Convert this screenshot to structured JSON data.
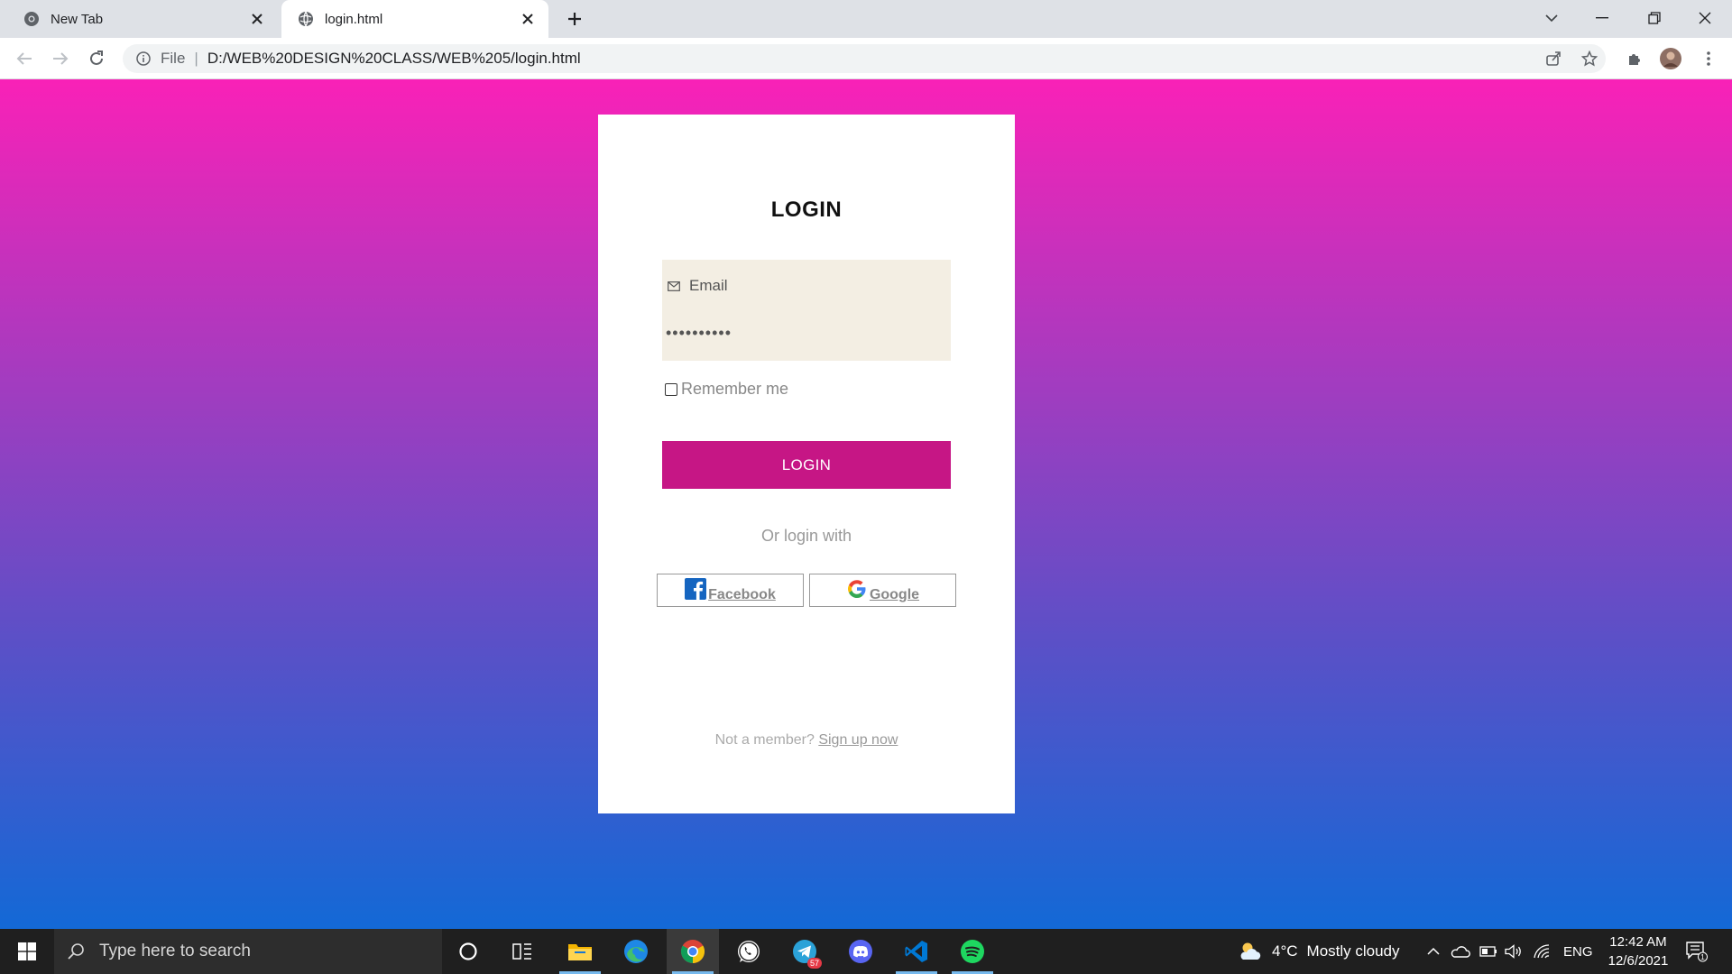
{
  "browser": {
    "tabs": [
      {
        "title": "New Tab",
        "active": false
      },
      {
        "title": "login.html",
        "active": true
      }
    ],
    "address": {
      "scheme_label": "File",
      "url": "D:/WEB%20DESIGN%20CLASS/WEB%205/login.html"
    }
  },
  "page": {
    "background_colors": [
      "#f921b7",
      "#1369d6"
    ],
    "card": {
      "title": "LOGIN",
      "email_placeholder": "Email",
      "password_value": "••••••••••",
      "remember_label": "Remember me",
      "remember_checked": false,
      "login_button": "LOGIN",
      "login_button_color": "#c61685",
      "or_text": "Or login with",
      "social": [
        {
          "label": "Facebook",
          "icon": "facebook-icon"
        },
        {
          "label": "Google",
          "icon": "google-icon"
        }
      ],
      "signup_prompt": "Not a member?",
      "signup_link": "Sign up now"
    }
  },
  "taskbar": {
    "search_placeholder": "Type here to search",
    "pinned": [
      "cortana-icon",
      "task-view-icon",
      "file-explorer-icon",
      "edge-icon",
      "chrome-icon",
      "whatsapp-icon",
      "telegram-icon",
      "discord-icon",
      "vscode-icon",
      "spotify-icon"
    ],
    "telegram_badge": "57",
    "weather": {
      "temp": "4°C",
      "condition": "Mostly cloudy"
    },
    "language": "ENG",
    "time": "12:42 AM",
    "date": "12/6/2021",
    "notification_count": "1"
  }
}
